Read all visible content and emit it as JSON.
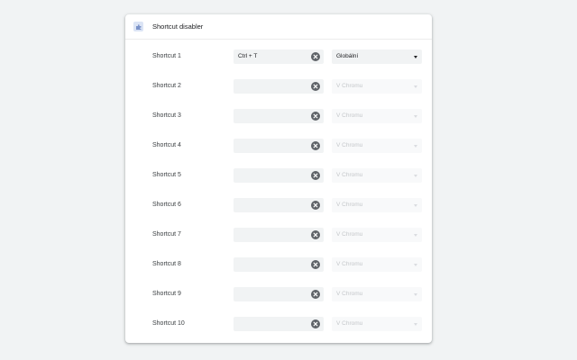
{
  "header": {
    "title": "Shortcut disabler",
    "icon": "puzzle-icon"
  },
  "shortcuts": [
    {
      "label": "Shortcut 1",
      "value": "Ctrl + T",
      "scope": "Globální",
      "scope_enabled": true
    },
    {
      "label": "Shortcut 2",
      "value": "",
      "scope": "V Chromu",
      "scope_enabled": false
    },
    {
      "label": "Shortcut 3",
      "value": "",
      "scope": "V Chromu",
      "scope_enabled": false
    },
    {
      "label": "Shortcut 4",
      "value": "",
      "scope": "V Chromu",
      "scope_enabled": false
    },
    {
      "label": "Shortcut 5",
      "value": "",
      "scope": "V Chromu",
      "scope_enabled": false
    },
    {
      "label": "Shortcut 6",
      "value": "",
      "scope": "V Chromu",
      "scope_enabled": false
    },
    {
      "label": "Shortcut 7",
      "value": "",
      "scope": "V Chromu",
      "scope_enabled": false
    },
    {
      "label": "Shortcut 8",
      "value": "",
      "scope": "V Chromu",
      "scope_enabled": false
    },
    {
      "label": "Shortcut 9",
      "value": "",
      "scope": "V Chromu",
      "scope_enabled": false
    },
    {
      "label": "Shortcut 10",
      "value": "",
      "scope": "V Chromu",
      "scope_enabled": false
    }
  ],
  "colors": {
    "background": "#f1f3f4",
    "card": "#ffffff",
    "clear_button": "#5f6368",
    "disabled_text": "#c4c7ca"
  }
}
